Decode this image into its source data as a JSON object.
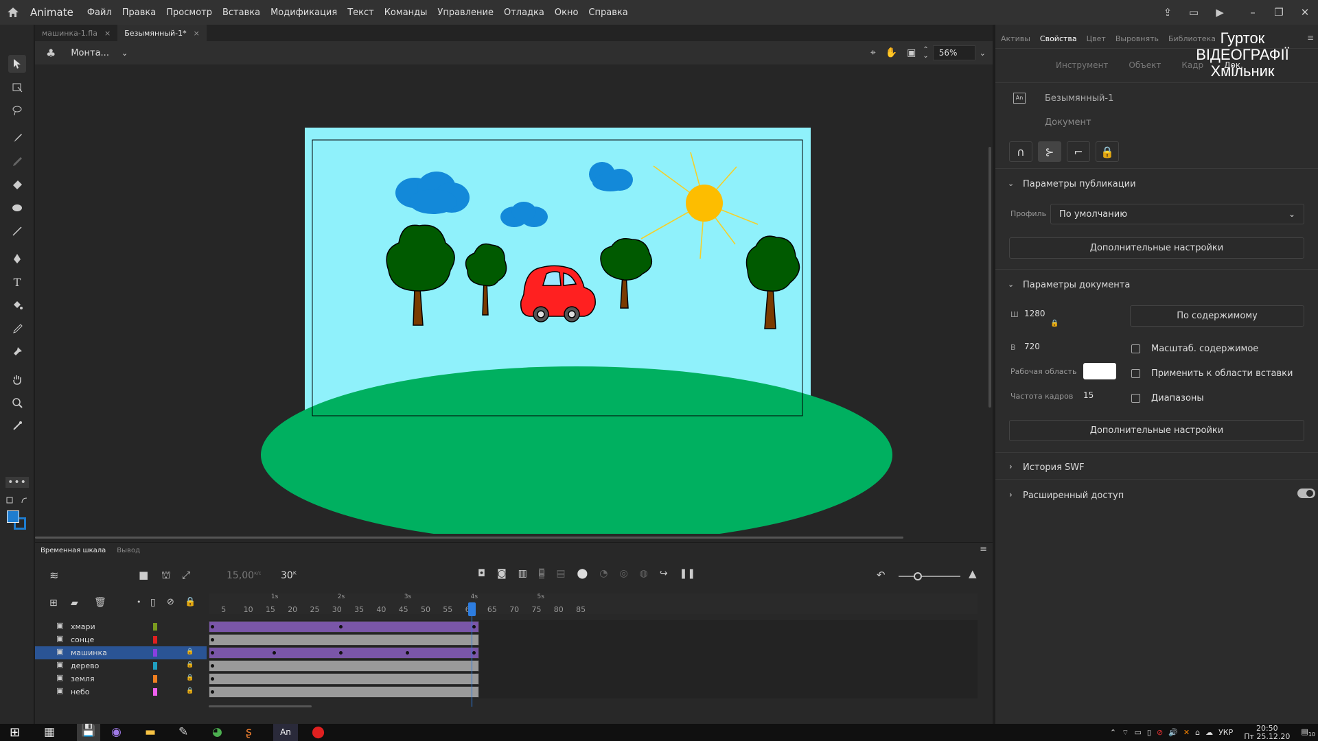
{
  "app": {
    "name": "Animate",
    "menu": [
      "Файл",
      "Правка",
      "Просмотр",
      "Вставка",
      "Модификация",
      "Текст",
      "Команды",
      "Управление",
      "Отладка",
      "Окно",
      "Справка"
    ]
  },
  "doc_tabs": [
    {
      "label": "машинка-1.fla"
    },
    {
      "label": "Безымянный-1*"
    }
  ],
  "stagebar": {
    "scene": "Монта...",
    "zoom": "56%"
  },
  "watermark": {
    "line1": "Гурток",
    "line2": "ВІДЕОГРАФІЇ",
    "line3": "Хмільник"
  },
  "right_panel": {
    "tabs": [
      "Активы",
      "Свойства",
      "Цвет",
      "Выровнять",
      "Библиотека"
    ],
    "subtabs": [
      "Инструмент",
      "Объект",
      "Кадр",
      "Док."
    ],
    "doc_name": "Безымянный-1",
    "doc_type": "Документ",
    "publish": {
      "title": "Параметры публикации",
      "profile_label": "Профиль",
      "profile_value": "По умолчанию",
      "more": "Дополнительные настройки"
    },
    "docparams": {
      "title": "Параметры документа",
      "w_label": "Ш",
      "w": "1280",
      "h_label": "В",
      "h": "720",
      "fit_btn": "По содержимому",
      "scale": "Масштаб. содержимое",
      "apply": "Применить к области вставки",
      "stage_label": "Рабочая область",
      "fps_label": "Частота кадров",
      "fps": "15",
      "ranges": "Диапазоны",
      "more": "Дополнительные настройки"
    },
    "swf_history": "История SWF",
    "access": "Расширенный доступ"
  },
  "timeline": {
    "tabs": [
      "Временная шкала",
      "Вывод"
    ],
    "fps": "15,00",
    "fps_unit": "к/с",
    "frame": "30",
    "frame_unit": "К",
    "seconds": [
      "1s",
      "2s",
      "3s",
      "4s",
      "5s"
    ],
    "ruler": [
      "5",
      "10",
      "15",
      "20",
      "25",
      "30",
      "35",
      "40",
      "45",
      "50",
      "55",
      "60",
      "65",
      "70",
      "75",
      "80",
      "85"
    ],
    "layers": [
      {
        "name": "хмари",
        "color": "#7a9b1f"
      },
      {
        "name": "сонце",
        "color": "#e02020"
      },
      {
        "name": "машинка",
        "color": "#8a3fe0"
      },
      {
        "name": "дерево",
        "color": "#20a0c0"
      },
      {
        "name": "земля",
        "color": "#f08020"
      },
      {
        "name": "небо",
        "color": "#f060f0"
      }
    ]
  },
  "taskbar": {
    "lang": "УКР",
    "time": "20:50",
    "date": "Пт 25.12.20",
    "notif": "10"
  },
  "colors": {
    "sky": "#8ff1fb",
    "grass": "#00b060",
    "accent": "#2a5495"
  }
}
